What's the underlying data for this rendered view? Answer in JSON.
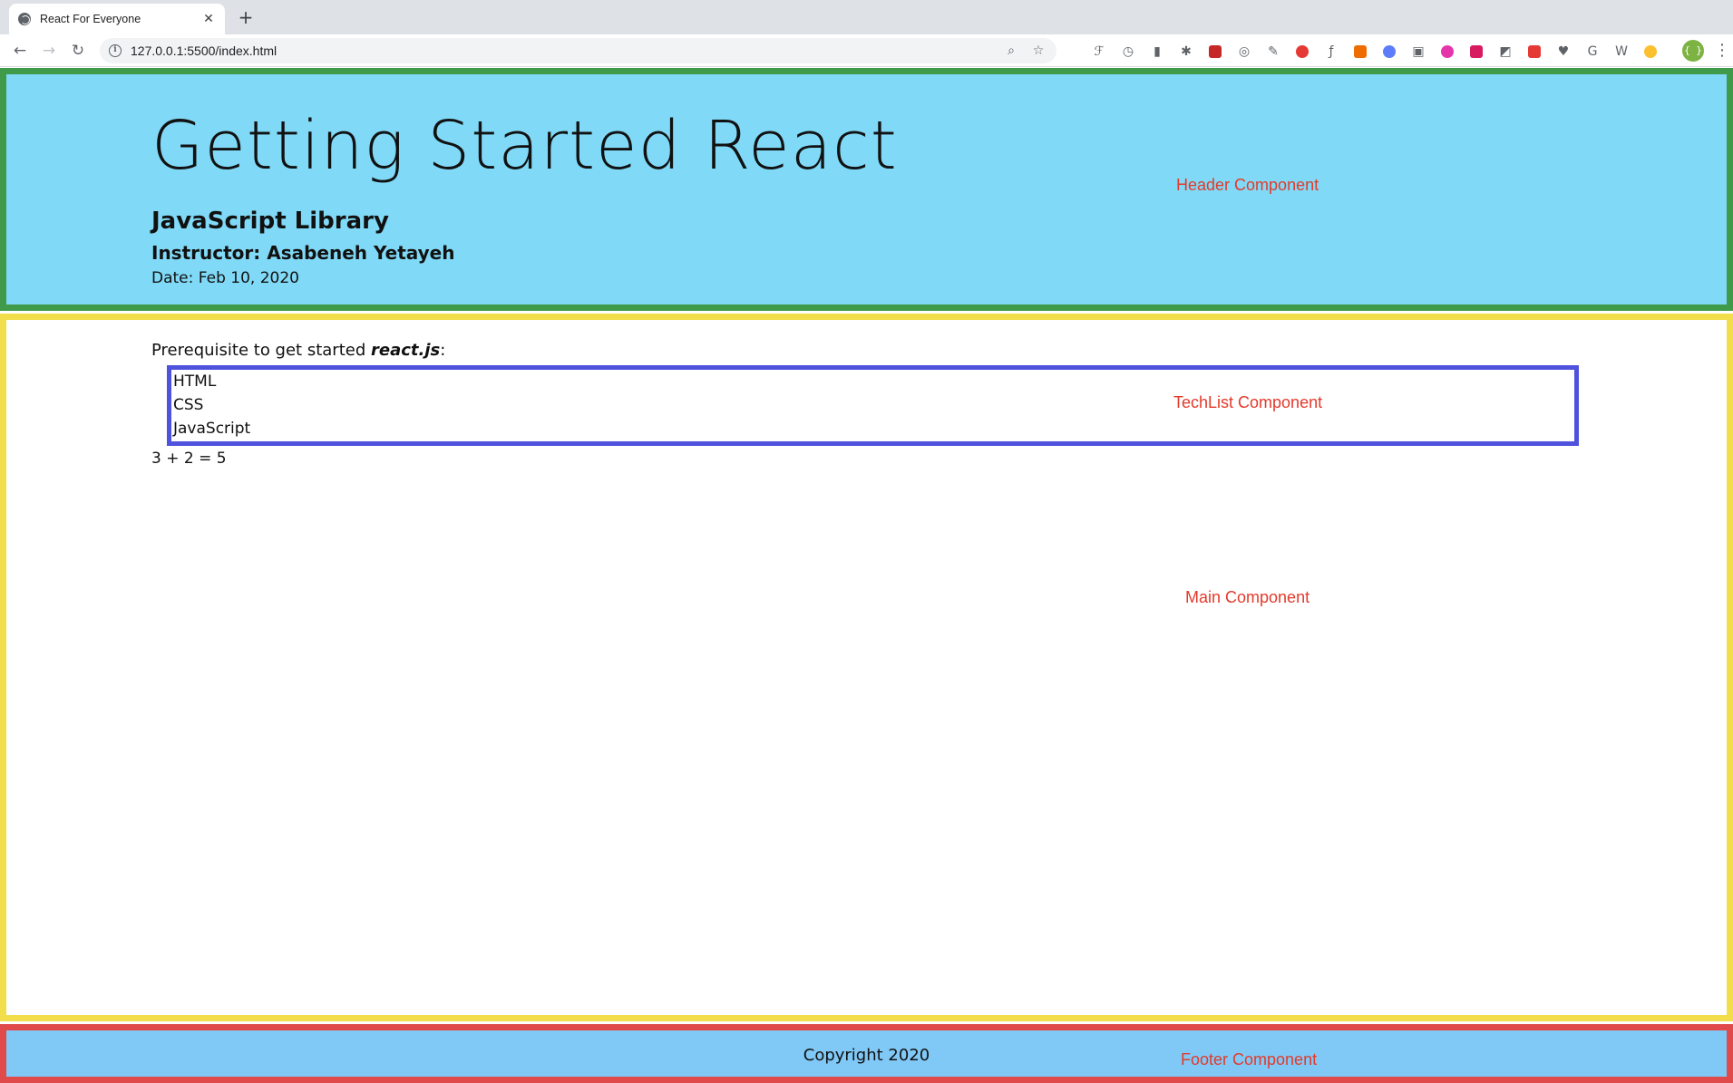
{
  "browser": {
    "tab_title": "React For Everyone",
    "tab_close": "✕",
    "new_tab": "+",
    "url": "127.0.0.1:5500/index.html"
  },
  "header": {
    "title": "Getting Started React",
    "subtitle": "JavaScript Library",
    "instructor": "Instructor: Asabeneh Yetayeh",
    "date": "Date: Feb 10, 2020"
  },
  "main": {
    "prereq_text": "Prerequisite to get started",
    "prereq_lib": "react.js",
    "prereq_suffix": ":",
    "techs": [
      "HTML",
      "CSS",
      "JavaScript"
    ],
    "sum": "3 + 2 = 5"
  },
  "footer": {
    "copyright": "Copyright 2020"
  },
  "annotations": {
    "header": "Header Component",
    "techlist": "TechList Component",
    "main": "Main Component",
    "footer": "Footer Component"
  },
  "colors": {
    "header_bg": "#80d9f6",
    "header_border": "#3f9a4a",
    "main_border": "#f2dd4a",
    "techlist_border": "#4e52dc",
    "footer_bg": "#80c8f6",
    "footer_border": "#e14a4a",
    "annotation": "#e33a2b"
  }
}
